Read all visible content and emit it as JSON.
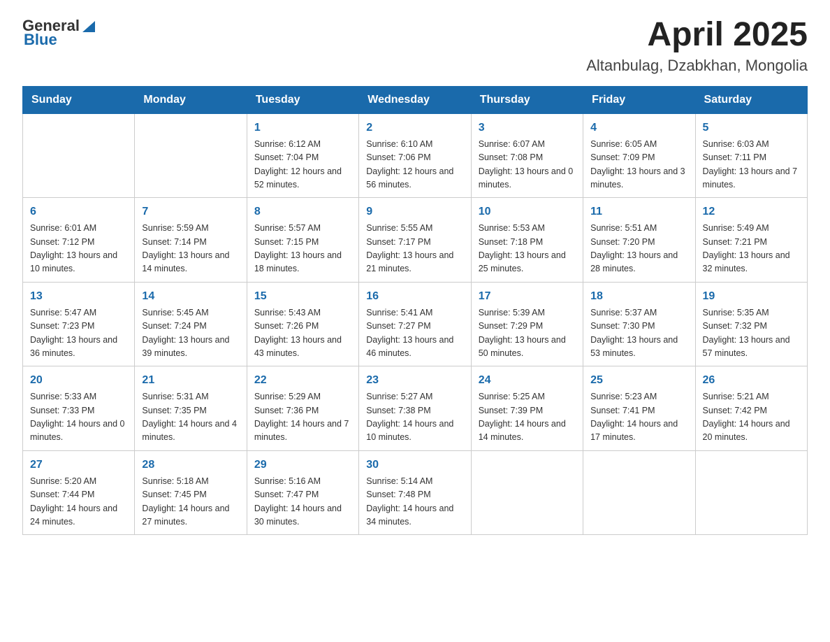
{
  "header": {
    "logo_general": "General",
    "logo_blue": "Blue",
    "title": "April 2025",
    "subtitle": "Altanbulag, Dzabkhan, Mongolia"
  },
  "days_of_week": [
    "Sunday",
    "Monday",
    "Tuesday",
    "Wednesday",
    "Thursday",
    "Friday",
    "Saturday"
  ],
  "weeks": [
    [
      {
        "day": "",
        "sunrise": "",
        "sunset": "",
        "daylight": ""
      },
      {
        "day": "",
        "sunrise": "",
        "sunset": "",
        "daylight": ""
      },
      {
        "day": "1",
        "sunrise": "Sunrise: 6:12 AM",
        "sunset": "Sunset: 7:04 PM",
        "daylight": "Daylight: 12 hours and 52 minutes."
      },
      {
        "day": "2",
        "sunrise": "Sunrise: 6:10 AM",
        "sunset": "Sunset: 7:06 PM",
        "daylight": "Daylight: 12 hours and 56 minutes."
      },
      {
        "day": "3",
        "sunrise": "Sunrise: 6:07 AM",
        "sunset": "Sunset: 7:08 PM",
        "daylight": "Daylight: 13 hours and 0 minutes."
      },
      {
        "day": "4",
        "sunrise": "Sunrise: 6:05 AM",
        "sunset": "Sunset: 7:09 PM",
        "daylight": "Daylight: 13 hours and 3 minutes."
      },
      {
        "day": "5",
        "sunrise": "Sunrise: 6:03 AM",
        "sunset": "Sunset: 7:11 PM",
        "daylight": "Daylight: 13 hours and 7 minutes."
      }
    ],
    [
      {
        "day": "6",
        "sunrise": "Sunrise: 6:01 AM",
        "sunset": "Sunset: 7:12 PM",
        "daylight": "Daylight: 13 hours and 10 minutes."
      },
      {
        "day": "7",
        "sunrise": "Sunrise: 5:59 AM",
        "sunset": "Sunset: 7:14 PM",
        "daylight": "Daylight: 13 hours and 14 minutes."
      },
      {
        "day": "8",
        "sunrise": "Sunrise: 5:57 AM",
        "sunset": "Sunset: 7:15 PM",
        "daylight": "Daylight: 13 hours and 18 minutes."
      },
      {
        "day": "9",
        "sunrise": "Sunrise: 5:55 AM",
        "sunset": "Sunset: 7:17 PM",
        "daylight": "Daylight: 13 hours and 21 minutes."
      },
      {
        "day": "10",
        "sunrise": "Sunrise: 5:53 AM",
        "sunset": "Sunset: 7:18 PM",
        "daylight": "Daylight: 13 hours and 25 minutes."
      },
      {
        "day": "11",
        "sunrise": "Sunrise: 5:51 AM",
        "sunset": "Sunset: 7:20 PM",
        "daylight": "Daylight: 13 hours and 28 minutes."
      },
      {
        "day": "12",
        "sunrise": "Sunrise: 5:49 AM",
        "sunset": "Sunset: 7:21 PM",
        "daylight": "Daylight: 13 hours and 32 minutes."
      }
    ],
    [
      {
        "day": "13",
        "sunrise": "Sunrise: 5:47 AM",
        "sunset": "Sunset: 7:23 PM",
        "daylight": "Daylight: 13 hours and 36 minutes."
      },
      {
        "day": "14",
        "sunrise": "Sunrise: 5:45 AM",
        "sunset": "Sunset: 7:24 PM",
        "daylight": "Daylight: 13 hours and 39 minutes."
      },
      {
        "day": "15",
        "sunrise": "Sunrise: 5:43 AM",
        "sunset": "Sunset: 7:26 PM",
        "daylight": "Daylight: 13 hours and 43 minutes."
      },
      {
        "day": "16",
        "sunrise": "Sunrise: 5:41 AM",
        "sunset": "Sunset: 7:27 PM",
        "daylight": "Daylight: 13 hours and 46 minutes."
      },
      {
        "day": "17",
        "sunrise": "Sunrise: 5:39 AM",
        "sunset": "Sunset: 7:29 PM",
        "daylight": "Daylight: 13 hours and 50 minutes."
      },
      {
        "day": "18",
        "sunrise": "Sunrise: 5:37 AM",
        "sunset": "Sunset: 7:30 PM",
        "daylight": "Daylight: 13 hours and 53 minutes."
      },
      {
        "day": "19",
        "sunrise": "Sunrise: 5:35 AM",
        "sunset": "Sunset: 7:32 PM",
        "daylight": "Daylight: 13 hours and 57 minutes."
      }
    ],
    [
      {
        "day": "20",
        "sunrise": "Sunrise: 5:33 AM",
        "sunset": "Sunset: 7:33 PM",
        "daylight": "Daylight: 14 hours and 0 minutes."
      },
      {
        "day": "21",
        "sunrise": "Sunrise: 5:31 AM",
        "sunset": "Sunset: 7:35 PM",
        "daylight": "Daylight: 14 hours and 4 minutes."
      },
      {
        "day": "22",
        "sunrise": "Sunrise: 5:29 AM",
        "sunset": "Sunset: 7:36 PM",
        "daylight": "Daylight: 14 hours and 7 minutes."
      },
      {
        "day": "23",
        "sunrise": "Sunrise: 5:27 AM",
        "sunset": "Sunset: 7:38 PM",
        "daylight": "Daylight: 14 hours and 10 minutes."
      },
      {
        "day": "24",
        "sunrise": "Sunrise: 5:25 AM",
        "sunset": "Sunset: 7:39 PM",
        "daylight": "Daylight: 14 hours and 14 minutes."
      },
      {
        "day": "25",
        "sunrise": "Sunrise: 5:23 AM",
        "sunset": "Sunset: 7:41 PM",
        "daylight": "Daylight: 14 hours and 17 minutes."
      },
      {
        "day": "26",
        "sunrise": "Sunrise: 5:21 AM",
        "sunset": "Sunset: 7:42 PM",
        "daylight": "Daylight: 14 hours and 20 minutes."
      }
    ],
    [
      {
        "day": "27",
        "sunrise": "Sunrise: 5:20 AM",
        "sunset": "Sunset: 7:44 PM",
        "daylight": "Daylight: 14 hours and 24 minutes."
      },
      {
        "day": "28",
        "sunrise": "Sunrise: 5:18 AM",
        "sunset": "Sunset: 7:45 PM",
        "daylight": "Daylight: 14 hours and 27 minutes."
      },
      {
        "day": "29",
        "sunrise": "Sunrise: 5:16 AM",
        "sunset": "Sunset: 7:47 PM",
        "daylight": "Daylight: 14 hours and 30 minutes."
      },
      {
        "day": "30",
        "sunrise": "Sunrise: 5:14 AM",
        "sunset": "Sunset: 7:48 PM",
        "daylight": "Daylight: 14 hours and 34 minutes."
      },
      {
        "day": "",
        "sunrise": "",
        "sunset": "",
        "daylight": ""
      },
      {
        "day": "",
        "sunrise": "",
        "sunset": "",
        "daylight": ""
      },
      {
        "day": "",
        "sunrise": "",
        "sunset": "",
        "daylight": ""
      }
    ]
  ]
}
